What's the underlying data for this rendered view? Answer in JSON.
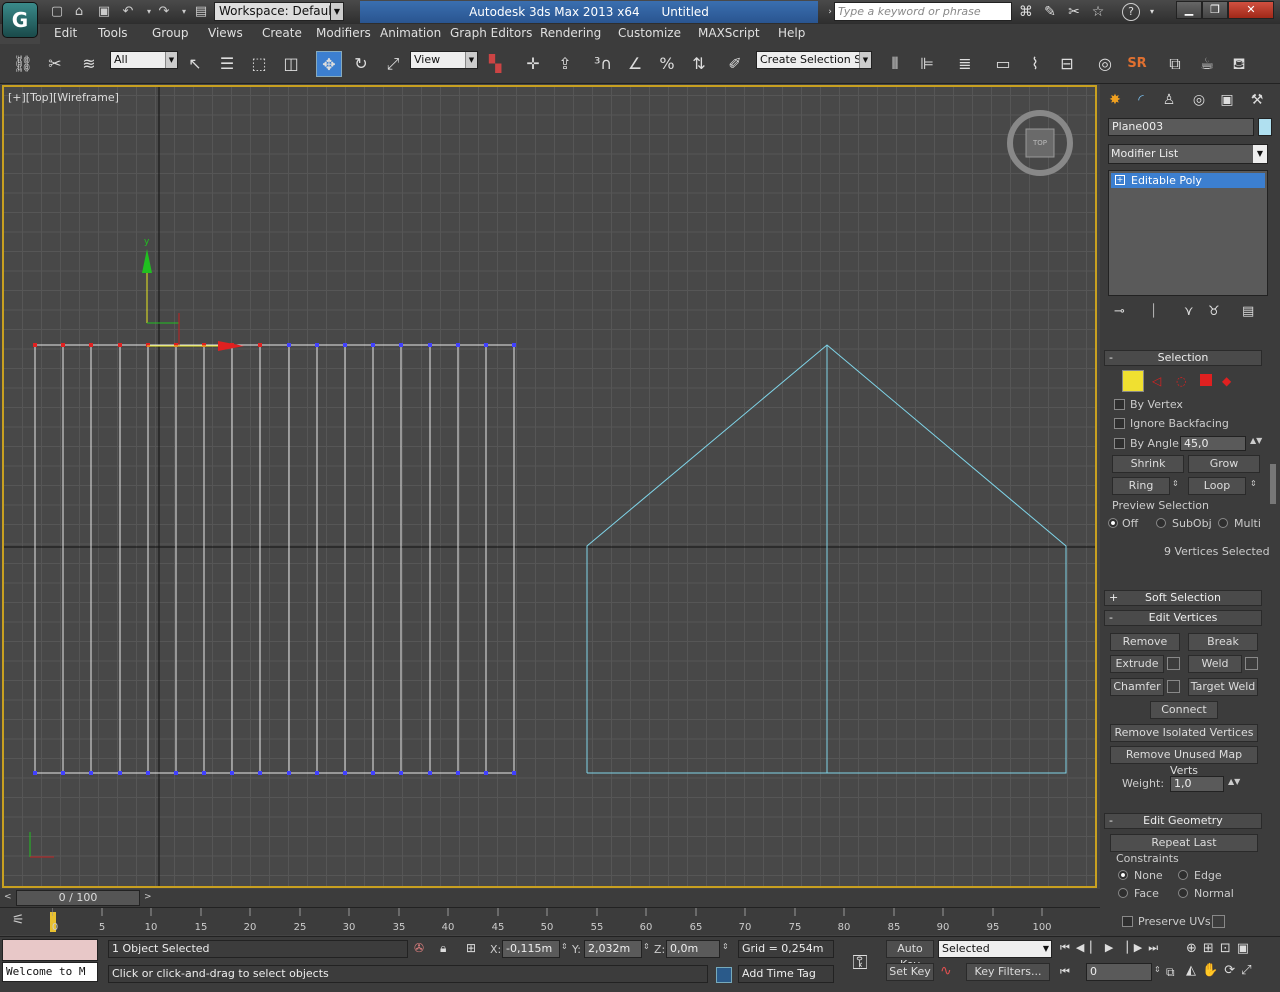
{
  "titlebar": {
    "workspace_label": "Workspace: Default",
    "app_title": "Autodesk 3ds Max  2013 x64",
    "doc_title": "Untitled",
    "search_placeholder": "Type a keyword or phrase"
  },
  "menubar": [
    "Edit",
    "Tools",
    "Group",
    "Views",
    "Create",
    "Modifiers",
    "Animation",
    "Graph Editors",
    "Rendering",
    "Customize",
    "MAXScript",
    "Help"
  ],
  "toolbar": {
    "filter_value": "All",
    "refcoord_value": "View",
    "selection_set_value": "Create Selection Se"
  },
  "viewport": {
    "label": "[+][Top][Wireframe]",
    "axis_y_label": "y",
    "viewcube_label": "TOP"
  },
  "command_panel": {
    "object_name": "Plane003",
    "object_color": "#b0e0f0",
    "modifier_list": "Modifier List",
    "stack_item": "Editable Poly",
    "selection": {
      "title": "Selection",
      "by_vertex": "By Vertex",
      "ignore_backfacing": "Ignore Backfacing",
      "by_angle": "By Angle:",
      "angle_value": "45,0",
      "shrink": "Shrink",
      "grow": "Grow",
      "ring": "Ring",
      "loop": "Loop",
      "preview_selection": "Preview Selection",
      "preview_off": "Off",
      "preview_subobj": "SubObj",
      "preview_multi": "Multi",
      "status": "9 Vertices Selected"
    },
    "soft_selection": "Soft Selection",
    "edit_vertices": {
      "title": "Edit Vertices",
      "remove": "Remove",
      "break": "Break",
      "extrude": "Extrude",
      "weld": "Weld",
      "chamfer": "Chamfer",
      "target_weld": "Target Weld",
      "connect": "Connect",
      "remove_isolated": "Remove Isolated Vertices",
      "remove_unused": "Remove Unused Map Verts",
      "weight_label": "Weight:",
      "weight_value": "1,0"
    },
    "edit_geometry": {
      "title": "Edit Geometry",
      "repeat_last": "Repeat Last",
      "constraints": "Constraints",
      "none": "None",
      "edge": "Edge",
      "face": "Face",
      "normal": "Normal",
      "preserve_uvs": "Preserve UVs"
    }
  },
  "timeline": {
    "frame_counter": "0 / 100",
    "ticks": [
      "0",
      "5",
      "10",
      "15",
      "20",
      "25",
      "30",
      "35",
      "40",
      "45",
      "50",
      "55",
      "60",
      "65",
      "70",
      "75",
      "80",
      "85",
      "90",
      "95",
      "100"
    ]
  },
  "status": {
    "maxscript_text": "Welcome to M",
    "selected_count": "1 Object Selected",
    "prompt": "Click or click-and-drag to select objects",
    "x_label": "X:",
    "x_value": "-0,115m",
    "y_label": "Y:",
    "y_value": "2,032m",
    "z_label": "Z:",
    "z_value": "0,0m",
    "grid": "Grid = 0,254m",
    "add_time_tag": "Add Time Tag",
    "auto_key": "Auto Key",
    "set_key": "Set Key",
    "selected_dropdown": "Selected",
    "key_filters": "Key Filters...",
    "frame_value": "0"
  }
}
